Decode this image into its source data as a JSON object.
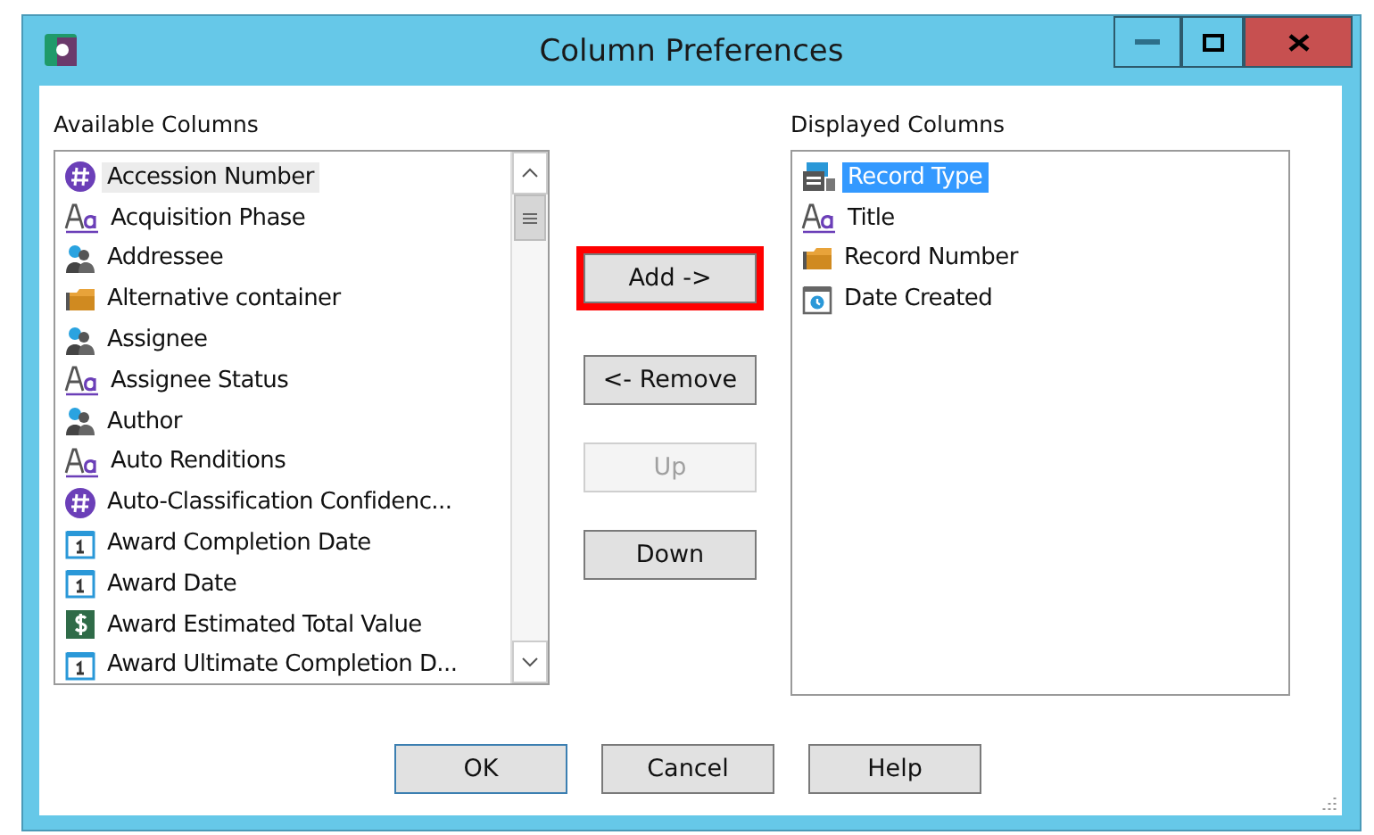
{
  "window": {
    "title": "Column Preferences"
  },
  "available": {
    "label": "Available Columns",
    "items": [
      {
        "label": "Accession Number",
        "kind": "number",
        "selected": true
      },
      {
        "label": "Acquisition Phase",
        "kind": "text",
        "selected": false
      },
      {
        "label": "Addressee",
        "kind": "people",
        "selected": false
      },
      {
        "label": "Alternative container",
        "kind": "folder",
        "selected": false
      },
      {
        "label": "Assignee",
        "kind": "people",
        "selected": false
      },
      {
        "label": "Assignee Status",
        "kind": "text",
        "selected": false
      },
      {
        "label": "Author",
        "kind": "people",
        "selected": false
      },
      {
        "label": "Auto Renditions",
        "kind": "text",
        "selected": false
      },
      {
        "label": "Auto-Classification Confidenc...",
        "kind": "number",
        "selected": false
      },
      {
        "label": "Award Completion Date",
        "kind": "date",
        "selected": false
      },
      {
        "label": "Award Date",
        "kind": "date",
        "selected": false
      },
      {
        "label": "Award Estimated Total Value",
        "kind": "money",
        "selected": false
      },
      {
        "label": "Award Ultimate Completion D...",
        "kind": "date",
        "selected": false
      }
    ]
  },
  "middle_buttons": [
    {
      "label": "Add ->",
      "disabled": false,
      "highlighted": true
    },
    {
      "label": "<- Remove",
      "disabled": false,
      "highlighted": false
    },
    {
      "label": "Up",
      "disabled": true,
      "highlighted": false
    },
    {
      "label": "Down",
      "disabled": false,
      "highlighted": false
    }
  ],
  "displayed": {
    "label": "Displayed Columns",
    "items": [
      {
        "label": "Record Type",
        "kind": "recordtype",
        "selected": true
      },
      {
        "label": "Title",
        "kind": "text",
        "selected": false
      },
      {
        "label": "Record Number",
        "kind": "folder",
        "selected": false
      },
      {
        "label": "Date Created",
        "kind": "alarm",
        "selected": false
      }
    ]
  },
  "footer_buttons": [
    {
      "label": "OK",
      "default": true
    },
    {
      "label": "Cancel",
      "default": false
    },
    {
      "label": "Help",
      "default": false
    }
  ]
}
